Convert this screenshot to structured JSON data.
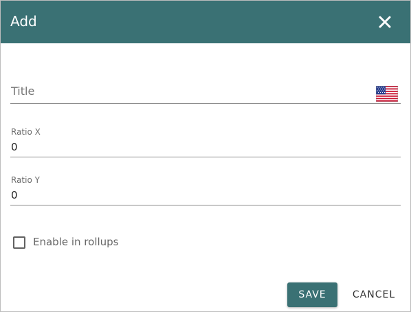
{
  "dialog": {
    "title": "Add",
    "close_icon": "close-icon"
  },
  "form": {
    "title_placeholder": "Title",
    "language_flag_icon": "us-flag-icon",
    "ratio_x": {
      "label": "Ratio X",
      "value": "0"
    },
    "ratio_y": {
      "label": "Ratio Y",
      "value": "0"
    },
    "enable_rollups": {
      "label": "Enable in rollups",
      "checked": false
    }
  },
  "actions": {
    "save_label": "SAVE",
    "cancel_label": "CANCEL"
  },
  "colors": {
    "header": "#3a7174",
    "primary": "#3a7174"
  }
}
